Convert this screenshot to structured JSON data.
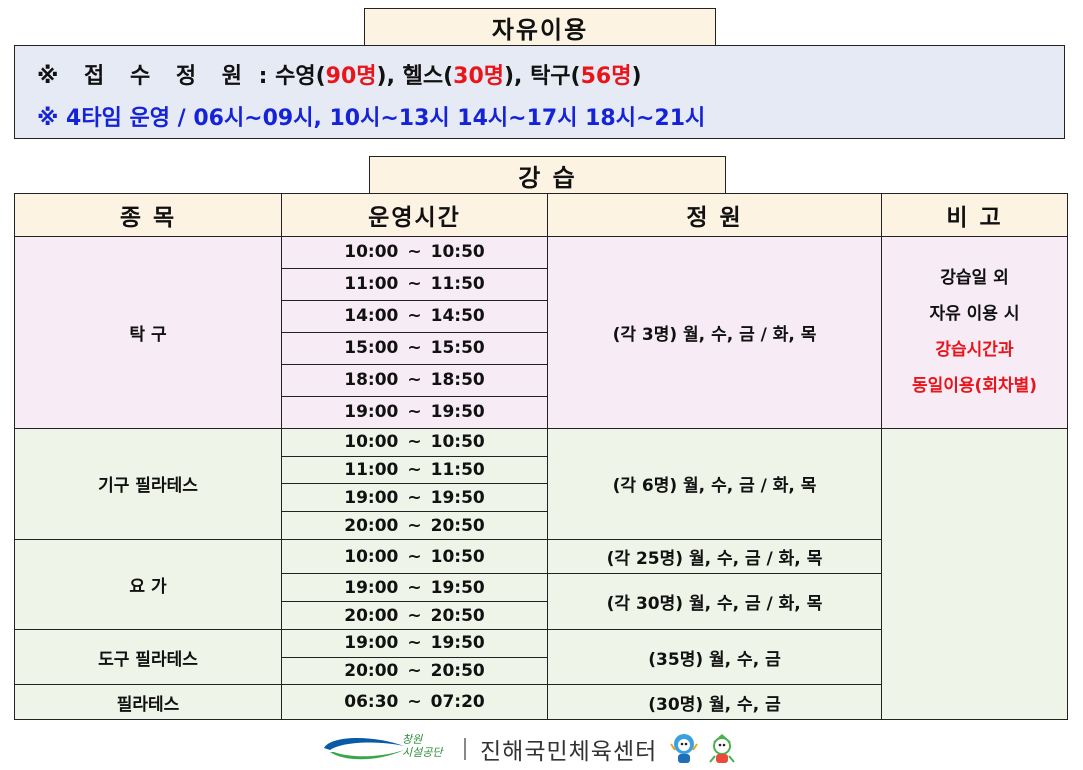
{
  "free_use": {
    "title": "자유이용",
    "line1": {
      "prefix": "※ 접 수 정 원",
      "sep": " : ",
      "swim_label": "수영(",
      "swim_count": "90명",
      "gym_label": "), 헬스(",
      "gym_count": "30명",
      "tt_label": "), 탁구(",
      "tt_count": "56명",
      "end": ")"
    },
    "line2": "※ 4타임 운영 / 06시~09시, 10시~13시 14시~17시 18시~21시"
  },
  "classes": {
    "title": "강 습",
    "headers": [
      "종 목",
      "운영시간",
      "정 원",
      "비 고"
    ],
    "rows": [
      {
        "time_start": "10:00",
        "time_end": "10:50"
      },
      {
        "time_start": "11:00",
        "time_end": "11:50"
      },
      {
        "time_start": "14:00",
        "time_end": "14:50"
      },
      {
        "time_start": "15:00",
        "time_end": "15:50"
      },
      {
        "time_start": "18:00",
        "time_end": "18:50"
      },
      {
        "time_start": "19:00",
        "time_end": "19:50"
      },
      {
        "time_start": "10:00",
        "time_end": "10:50"
      },
      {
        "time_start": "11:00",
        "time_end": "11:50"
      },
      {
        "time_start": "19:00",
        "time_end": "19:50"
      },
      {
        "time_start": "20:00",
        "time_end": "20:50"
      },
      {
        "time_start": "10:00",
        "time_end": "10:50"
      },
      {
        "time_start": "19:00",
        "time_end": "19:50"
      },
      {
        "time_start": "20:00",
        "time_end": "20:50"
      },
      {
        "time_start": "19:00",
        "time_end": "19:50"
      },
      {
        "time_start": "20:00",
        "time_end": "20:50"
      },
      {
        "time_start": "06:30",
        "time_end": "07:20"
      }
    ],
    "tilde": "~",
    "sports": {
      "table_tennis": "탁 구",
      "equip_pilates": "기구 필라테스",
      "yoga": "요 가",
      "tool_pilates": "도구 필라테스",
      "pilates": "필라테스"
    },
    "capacity": {
      "table_tennis": "(각 3명) 월, 수, 금 / 화, 목",
      "equip_pilates": "(각 6명) 월, 수, 금 / 화, 목",
      "yoga_1": "(각 25명) 월, 수, 금 / 화, 목",
      "yoga_2": "(각 30명) 월, 수, 금 / 화, 목",
      "tool_pilates": "(35명) 월, 수, 금",
      "pilates": "(30명) 월, 수, 금"
    },
    "note": {
      "line1": "강습일 외",
      "line2": "자유 이용 시",
      "line3": "강습시간과",
      "line4": "동일이용(회차별)"
    }
  },
  "footer": {
    "logo_text_1": "창원",
    "logo_text_2": "시설공단",
    "center_name": "진해국민체육센터",
    "logo_icon": "swoosh-logo-icon",
    "mascot_icon": "mascot-icon"
  },
  "colors": {
    "header_bg": "#fdf3e3",
    "info_bg": "#e6eaf4",
    "table_tennis_bg": "#f7ecf5",
    "other_bg": "#eef4e8",
    "red": "#e8151b",
    "blue": "#1523d8"
  }
}
